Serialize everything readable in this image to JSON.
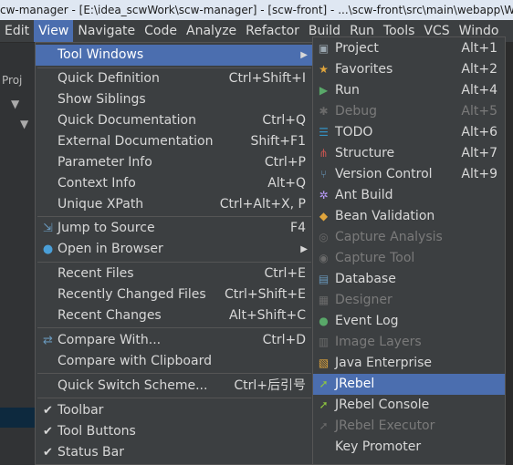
{
  "window": {
    "title": "cw-manager - [E:\\idea_scwWork\\scw-manager] - [scw-front] - ...\\scw-front\\src\\main\\webapp\\WEB-"
  },
  "menubar": [
    "Edit",
    "View",
    "Navigate",
    "Code",
    "Analyze",
    "Refactor",
    "Build",
    "Run",
    "Tools",
    "VCS",
    "Windo"
  ],
  "ide": {
    "left_tab": "Proj"
  },
  "view_menu": {
    "items": [
      {
        "label": "Tool Windows",
        "submenu": true,
        "highlighted": true
      },
      {
        "label": "Quick Definition",
        "shortcut": "Ctrl+Shift+I"
      },
      {
        "label": "Show Siblings",
        "shortcut": ""
      },
      {
        "label": "Quick Documentation",
        "shortcut": "Ctrl+Q"
      },
      {
        "label": "External Documentation",
        "shortcut": "Shift+F1"
      },
      {
        "label": "Parameter Info",
        "shortcut": "Ctrl+P"
      },
      {
        "label": "Context Info",
        "shortcut": "Alt+Q"
      },
      {
        "label": "Unique XPath",
        "shortcut": "Ctrl+Alt+X, P"
      },
      {
        "label": "Jump to Source",
        "shortcut": "F4",
        "icon": "jump-icon"
      },
      {
        "label": "Open in Browser",
        "submenu": true,
        "icon": "globe-icon"
      },
      {
        "label": "Recent Files",
        "shortcut": "Ctrl+E"
      },
      {
        "label": "Recently Changed Files",
        "shortcut": "Ctrl+Shift+E"
      },
      {
        "label": "Recent Changes",
        "shortcut": "Alt+Shift+C"
      },
      {
        "label": "Compare With...",
        "shortcut": "Ctrl+D",
        "icon": "compare-icon"
      },
      {
        "label": "Compare with Clipboard",
        "shortcut": ""
      },
      {
        "label": "Quick Switch Scheme...",
        "shortcut": "Ctrl+后引号"
      },
      {
        "label": "Toolbar",
        "checked": true
      },
      {
        "label": "Tool Buttons",
        "checked": true
      },
      {
        "label": "Status Bar",
        "checked": true
      }
    ]
  },
  "tool_windows_submenu": {
    "items": [
      {
        "label": "Project",
        "shortcut": "Alt+1",
        "icon": "project-icon",
        "color": "#9aa7b0"
      },
      {
        "label": "Favorites",
        "shortcut": "Alt+2",
        "icon": "star-icon",
        "color": "#e0a53c"
      },
      {
        "label": "Run",
        "shortcut": "Alt+4",
        "icon": "run-icon",
        "color": "#59a869"
      },
      {
        "label": "Debug",
        "shortcut": "Alt+5",
        "icon": "debug-icon",
        "disabled": true
      },
      {
        "label": "TODO",
        "shortcut": "Alt+6",
        "icon": "todo-icon",
        "color": "#3592c4"
      },
      {
        "label": "Structure",
        "shortcut": "Alt+7",
        "icon": "structure-icon",
        "color": "#c75450"
      },
      {
        "label": "Version Control",
        "shortcut": "Alt+9",
        "icon": "vcs-icon",
        "color": "#6897bb"
      },
      {
        "label": "Ant Build",
        "shortcut": "",
        "icon": "ant-icon",
        "color": "#b99bf8"
      },
      {
        "label": "Bean Validation",
        "shortcut": "",
        "icon": "bean-icon",
        "color": "#e0a53c"
      },
      {
        "label": "Capture Analysis",
        "shortcut": "",
        "icon": "capture-analysis-icon",
        "disabled": true
      },
      {
        "label": "Capture Tool",
        "shortcut": "",
        "icon": "capture-tool-icon",
        "disabled": true
      },
      {
        "label": "Database",
        "shortcut": "",
        "icon": "database-icon",
        "color": "#6897bb"
      },
      {
        "label": "Designer",
        "shortcut": "",
        "icon": "designer-icon",
        "disabled": true
      },
      {
        "label": "Event Log",
        "shortcut": "",
        "icon": "event-log-icon",
        "color": "#59a869"
      },
      {
        "label": "Image Layers",
        "shortcut": "",
        "icon": "image-layers-icon",
        "disabled": true
      },
      {
        "label": "Java Enterprise",
        "shortcut": "",
        "icon": "java-ee-icon",
        "color": "#e0a53c"
      },
      {
        "label": "JRebel",
        "shortcut": "",
        "icon": "jrebel-icon",
        "color": "#8ec63f",
        "highlighted": true
      },
      {
        "label": "JRebel Console",
        "shortcut": "",
        "icon": "jrebel-console-icon",
        "color": "#8ec63f"
      },
      {
        "label": "JRebel Executor",
        "shortcut": "",
        "icon": "jrebel-executor-icon",
        "disabled": true
      },
      {
        "label": "Key Promoter",
        "shortcut": ""
      }
    ]
  }
}
